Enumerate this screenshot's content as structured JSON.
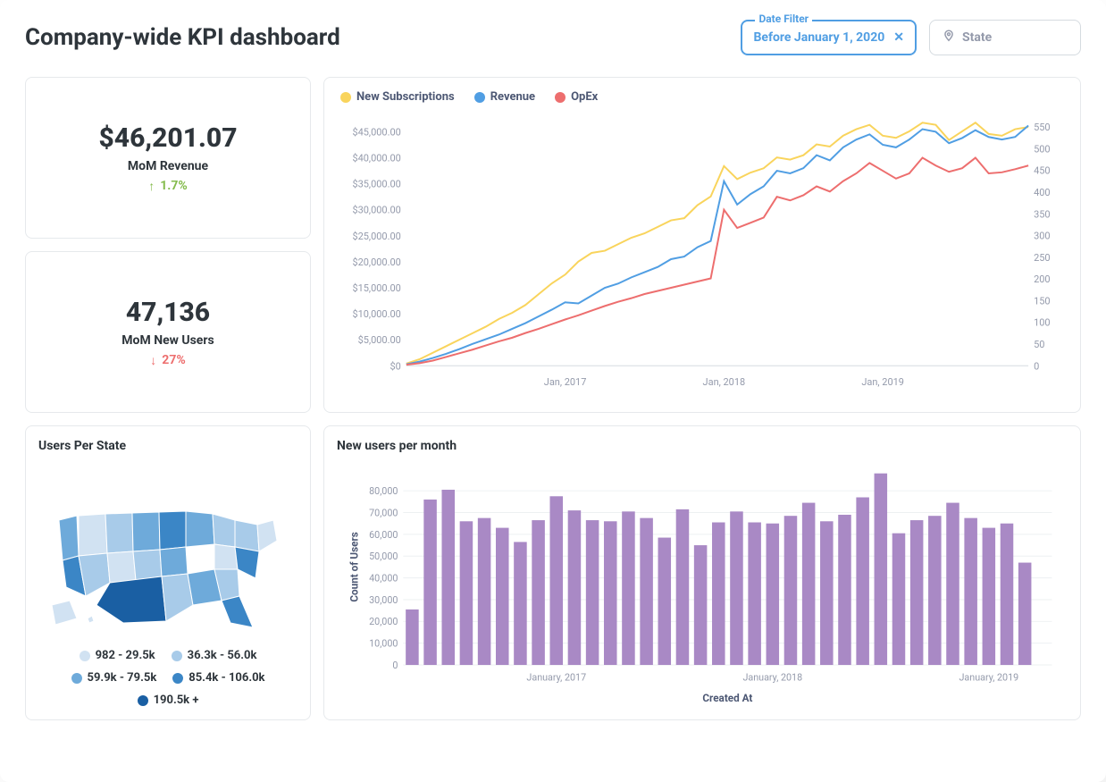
{
  "title": "Company-wide KPI dashboard",
  "filters": {
    "date_filter_legend": "Date Filter",
    "date_filter_value": "Before January 1, 2020",
    "state_placeholder": "State"
  },
  "kpi": {
    "revenue_value": "$46,201.07",
    "revenue_label": "MoM Revenue",
    "revenue_delta": "1.7%",
    "users_value": "47,136",
    "users_label": "MoM New Users",
    "users_delta": "27%"
  },
  "map": {
    "title": "Users Per State",
    "legend": [
      "982 - 29.5k",
      "36.3k - 56.0k",
      "59.9k - 79.5k",
      "85.4k - 106.0k",
      "190.5k +"
    ],
    "palette": [
      "#d1e2f2",
      "#a8cbe9",
      "#6eaada",
      "#3b86c6",
      "#1a5fa3"
    ]
  },
  "line_chart": {
    "legend": [
      "New Subscriptions",
      "Revenue",
      "OpEx"
    ],
    "colors": [
      "#f9d45c",
      "#509ee3",
      "#ed6e6e"
    ]
  },
  "bar_chart": {
    "title": "New users per month",
    "xlabel": "Created At",
    "ylabel": "Count of Users",
    "color": "#a989c5"
  },
  "chart_data": [
    {
      "type": "line",
      "title": "",
      "x_ticks": [
        "Jan, 2017",
        "Jan, 2018",
        "Jan, 2019"
      ],
      "y_left_ticks": [
        "$0",
        "$5,000.00",
        "$10,000.00",
        "$15,000.00",
        "$20,000.00",
        "$25,000.00",
        "$30,000.00",
        "$35,000.00",
        "$40,000.00",
        "$45,000.00"
      ],
      "y_right_ticks": [
        "0",
        "50",
        "100",
        "150",
        "200",
        "250",
        "300",
        "350",
        "400",
        "450",
        "500",
        "550"
      ],
      "y_left_lim": [
        0,
        48000
      ],
      "y_right_lim": [
        0,
        575
      ],
      "x_count": 48,
      "series": [
        {
          "name": "New Subscriptions",
          "axis": "right",
          "color": "#f9d45c",
          "values": [
            5,
            15,
            30,
            45,
            60,
            75,
            90,
            108,
            122,
            140,
            165,
            190,
            210,
            240,
            260,
            265,
            280,
            295,
            305,
            320,
            335,
            340,
            370,
            390,
            460,
            430,
            445,
            455,
            480,
            475,
            485,
            510,
            505,
            530,
            545,
            555,
            530,
            525,
            540,
            560,
            555,
            520,
            540,
            560,
            534,
            530,
            545,
            550
          ]
        },
        {
          "name": "Revenue",
          "axis": "left",
          "color": "#509ee3",
          "values": [
            300,
            800,
            1500,
            2300,
            3200,
            4200,
            5100,
            6000,
            7100,
            8200,
            9500,
            10800,
            12200,
            12000,
            13500,
            15000,
            15800,
            17000,
            18000,
            19000,
            20500,
            21000,
            22800,
            24000,
            35500,
            31000,
            33000,
            34500,
            37500,
            37000,
            38000,
            40500,
            39500,
            42000,
            43500,
            44500,
            42500,
            42000,
            43500,
            45500,
            45000,
            42800,
            43800,
            45300,
            44000,
            43500,
            44000,
            46201
          ]
        },
        {
          "name": "OpEx",
          "axis": "left",
          "color": "#ed6e6e",
          "values": [
            200,
            500,
            1000,
            1700,
            2400,
            3100,
            3900,
            4700,
            5400,
            6300,
            7100,
            8000,
            8900,
            9700,
            10600,
            11500,
            12300,
            13000,
            13800,
            14400,
            15000,
            15600,
            16200,
            16800,
            30000,
            26500,
            27500,
            28500,
            32500,
            31800,
            32800,
            34500,
            33500,
            35500,
            37000,
            39000,
            37500,
            36000,
            37000,
            40000,
            38500,
            37300,
            38000,
            40000,
            37000,
            37200,
            37800,
            38500
          ]
        }
      ]
    },
    {
      "type": "bar",
      "title": "New users per month",
      "xlabel": "Created At",
      "ylabel": "Count of Users",
      "y_ticks": [
        "0",
        "10,000",
        "20,000",
        "30,000",
        "40,000",
        "50,000",
        "60,000",
        "70,000",
        "80,000"
      ],
      "ylim": [
        0,
        90000
      ],
      "x_ticks": [
        "January, 2017",
        "January, 2018",
        "January, 2019"
      ],
      "x_tick_positions": [
        8,
        20,
        32
      ],
      "categories_count": 36,
      "values": [
        25500,
        76000,
        80500,
        66000,
        67500,
        63000,
        56500,
        66500,
        77500,
        71000,
        66500,
        66000,
        70500,
        67500,
        58500,
        71500,
        55000,
        65500,
        70500,
        65500,
        65000,
        68500,
        74500,
        66000,
        69000,
        77000,
        88000,
        60500,
        66500,
        68500,
        74500,
        67500,
        63000,
        65000,
        47000,
        0
      ],
      "color": "#a989c5"
    }
  ]
}
